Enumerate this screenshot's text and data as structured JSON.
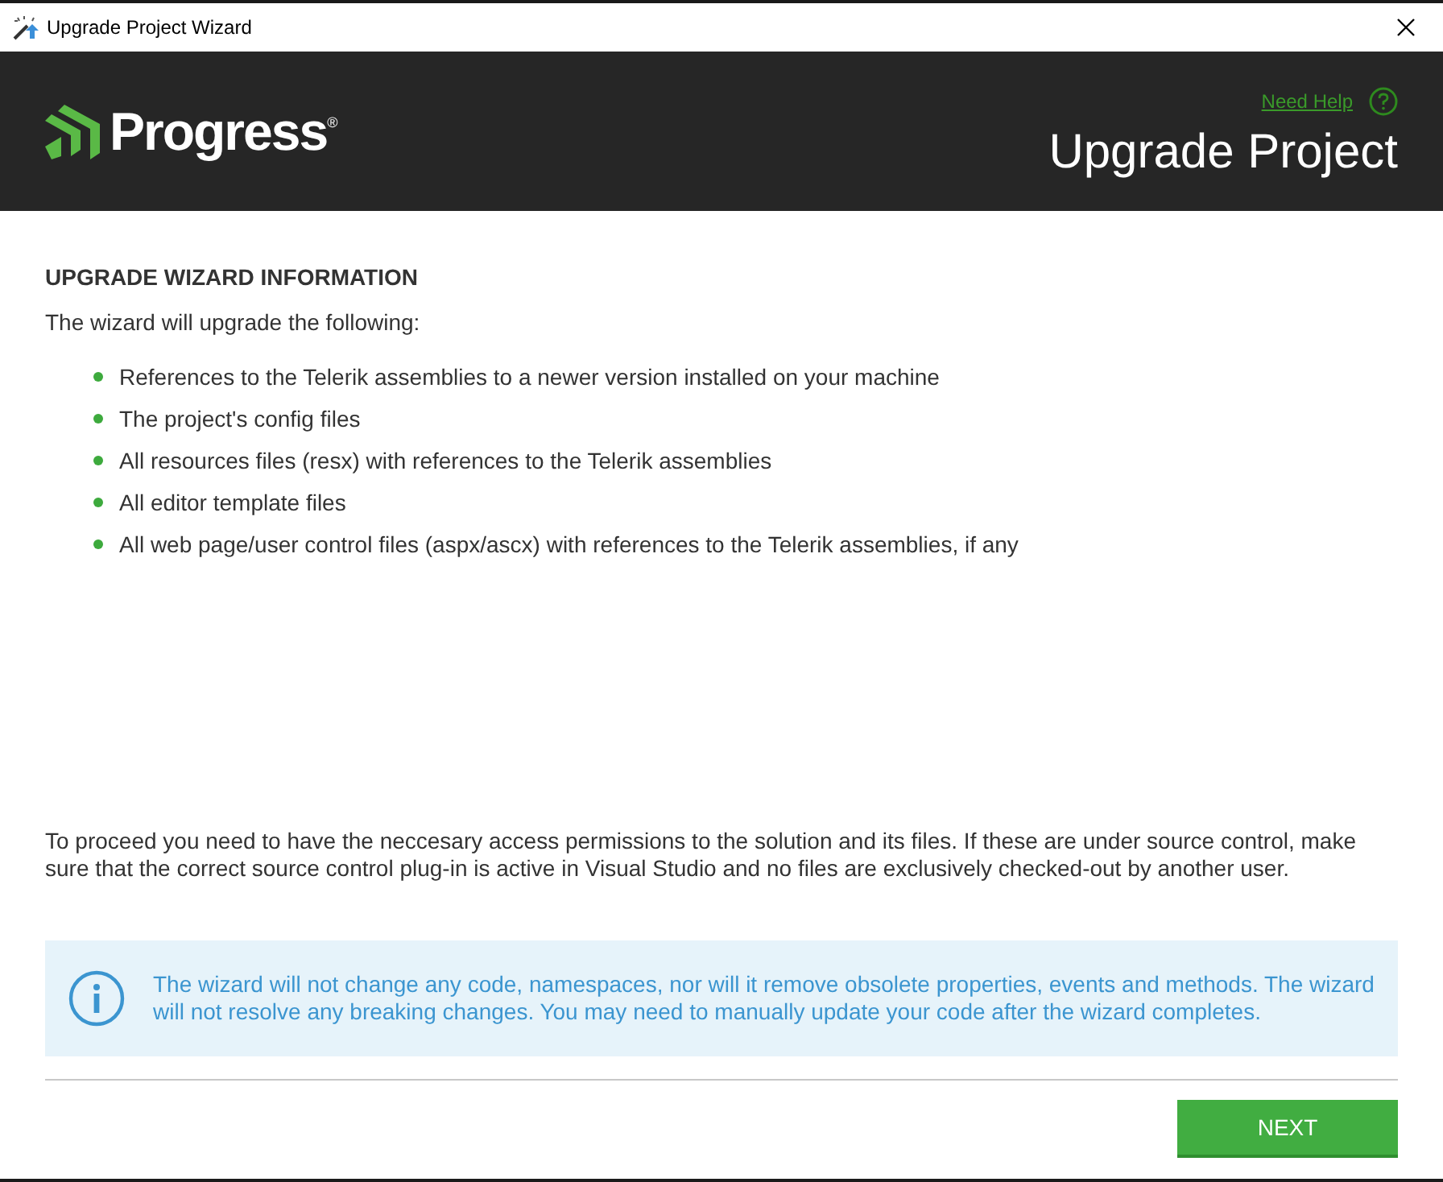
{
  "window": {
    "title": "Upgrade Project Wizard"
  },
  "header": {
    "logo": "Progress$^{®}$",
    "help_link": "Need Help",
    "title": "Upgrade Project"
  },
  "section_title": "UPGRADE WIZARD INFORMATION",
  "intro": "The wizard will upgrade the following:",
  "items": [
    "References to the Telerik assemblies to a newer version installed on your machine",
    "The project's config files",
    "All resources files (resx) with references to the Telerik assemblies",
    "All editor template files",
    "All web page/user control files (aspx/ascx) with references to the Telerik assemblies, if any"
  ],
  "note": "To proceed you need to have the neccesary access permissions to the solution and its files. If these are under source control, make sure that the correct source control plug-in is active in Visual Studio and no files are exclusively checked-out by another user.",
  "info": "The wizard will not change any code, namespaces, nor will it remove obsolete properties, events and methods. The wizard will not resolve any breaking changes. You may need to manually update your code after the wizard completes.",
  "buttons": [
    "NEXT"
  ]
}
